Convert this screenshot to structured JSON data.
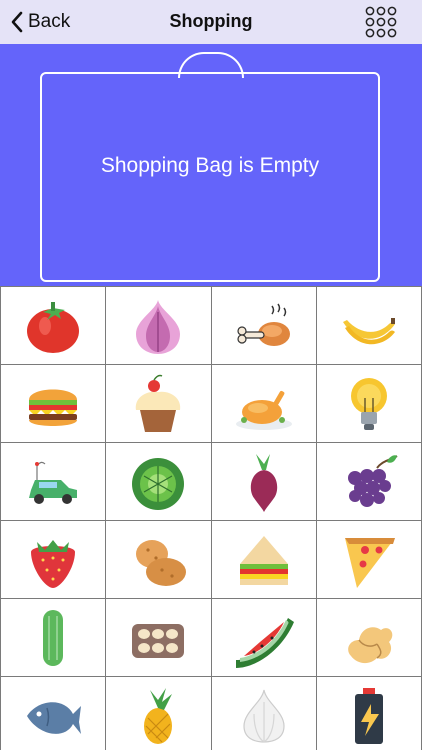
{
  "nav": {
    "back_label": "Back",
    "title": "Shopping",
    "menu_icon": "grid-dots-icon",
    "back_icon": "chevron-left-icon"
  },
  "bag": {
    "status_text": "Shopping Bag is Empty"
  },
  "colors": {
    "nav_bg": "#e5e3f7",
    "banner_bg": "#6464fa",
    "grid_line": "#7a7a7a"
  },
  "items": [
    {
      "icon": "tomato-icon"
    },
    {
      "icon": "onion-icon"
    },
    {
      "icon": "chicken-leg-icon"
    },
    {
      "icon": "banana-icon"
    },
    {
      "icon": "burger-icon"
    },
    {
      "icon": "cupcake-icon"
    },
    {
      "icon": "roast-chicken-icon"
    },
    {
      "icon": "light-bulb-icon"
    },
    {
      "icon": "toy-car-icon"
    },
    {
      "icon": "cabbage-icon"
    },
    {
      "icon": "beet-icon"
    },
    {
      "icon": "grapes-icon"
    },
    {
      "icon": "strawberry-icon"
    },
    {
      "icon": "potato-icon"
    },
    {
      "icon": "sandwich-icon"
    },
    {
      "icon": "pizza-slice-icon"
    },
    {
      "icon": "cucumber-icon"
    },
    {
      "icon": "eggs-carton-icon"
    },
    {
      "icon": "watermelon-icon"
    },
    {
      "icon": "ginger-icon"
    },
    {
      "icon": "fish-icon"
    },
    {
      "icon": "pineapple-icon"
    },
    {
      "icon": "garlic-icon"
    },
    {
      "icon": "battery-icon"
    }
  ]
}
